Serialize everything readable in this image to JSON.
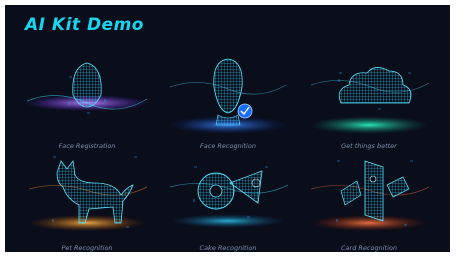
{
  "app": {
    "title": "AI Kit Demo"
  },
  "tiles": [
    {
      "label": "Face Registration",
      "glow": "#b36bff",
      "icon": "wireframe-head-icon"
    },
    {
      "label": "Face Recognition",
      "glow": "#2f7bff",
      "icon": "wireframe-face-check-icon"
    },
    {
      "label": "Get things better",
      "glow": "#1fe6b4",
      "icon": "wireframe-cloud-icon"
    },
    {
      "label": "Pet Recognition",
      "glow": "#ff9a2b",
      "icon": "wireframe-cat-icon"
    },
    {
      "label": "Cake Recognition",
      "glow": "#23c8ff",
      "icon": "wireframe-cake-icon"
    },
    {
      "label": "Card Recognition",
      "glow": "#ff6a3d",
      "icon": "wireframe-cards-icon"
    }
  ],
  "theme": {
    "accent": "#19d6f0",
    "background": "#0a0d1a",
    "label": "#7d8fb0"
  }
}
